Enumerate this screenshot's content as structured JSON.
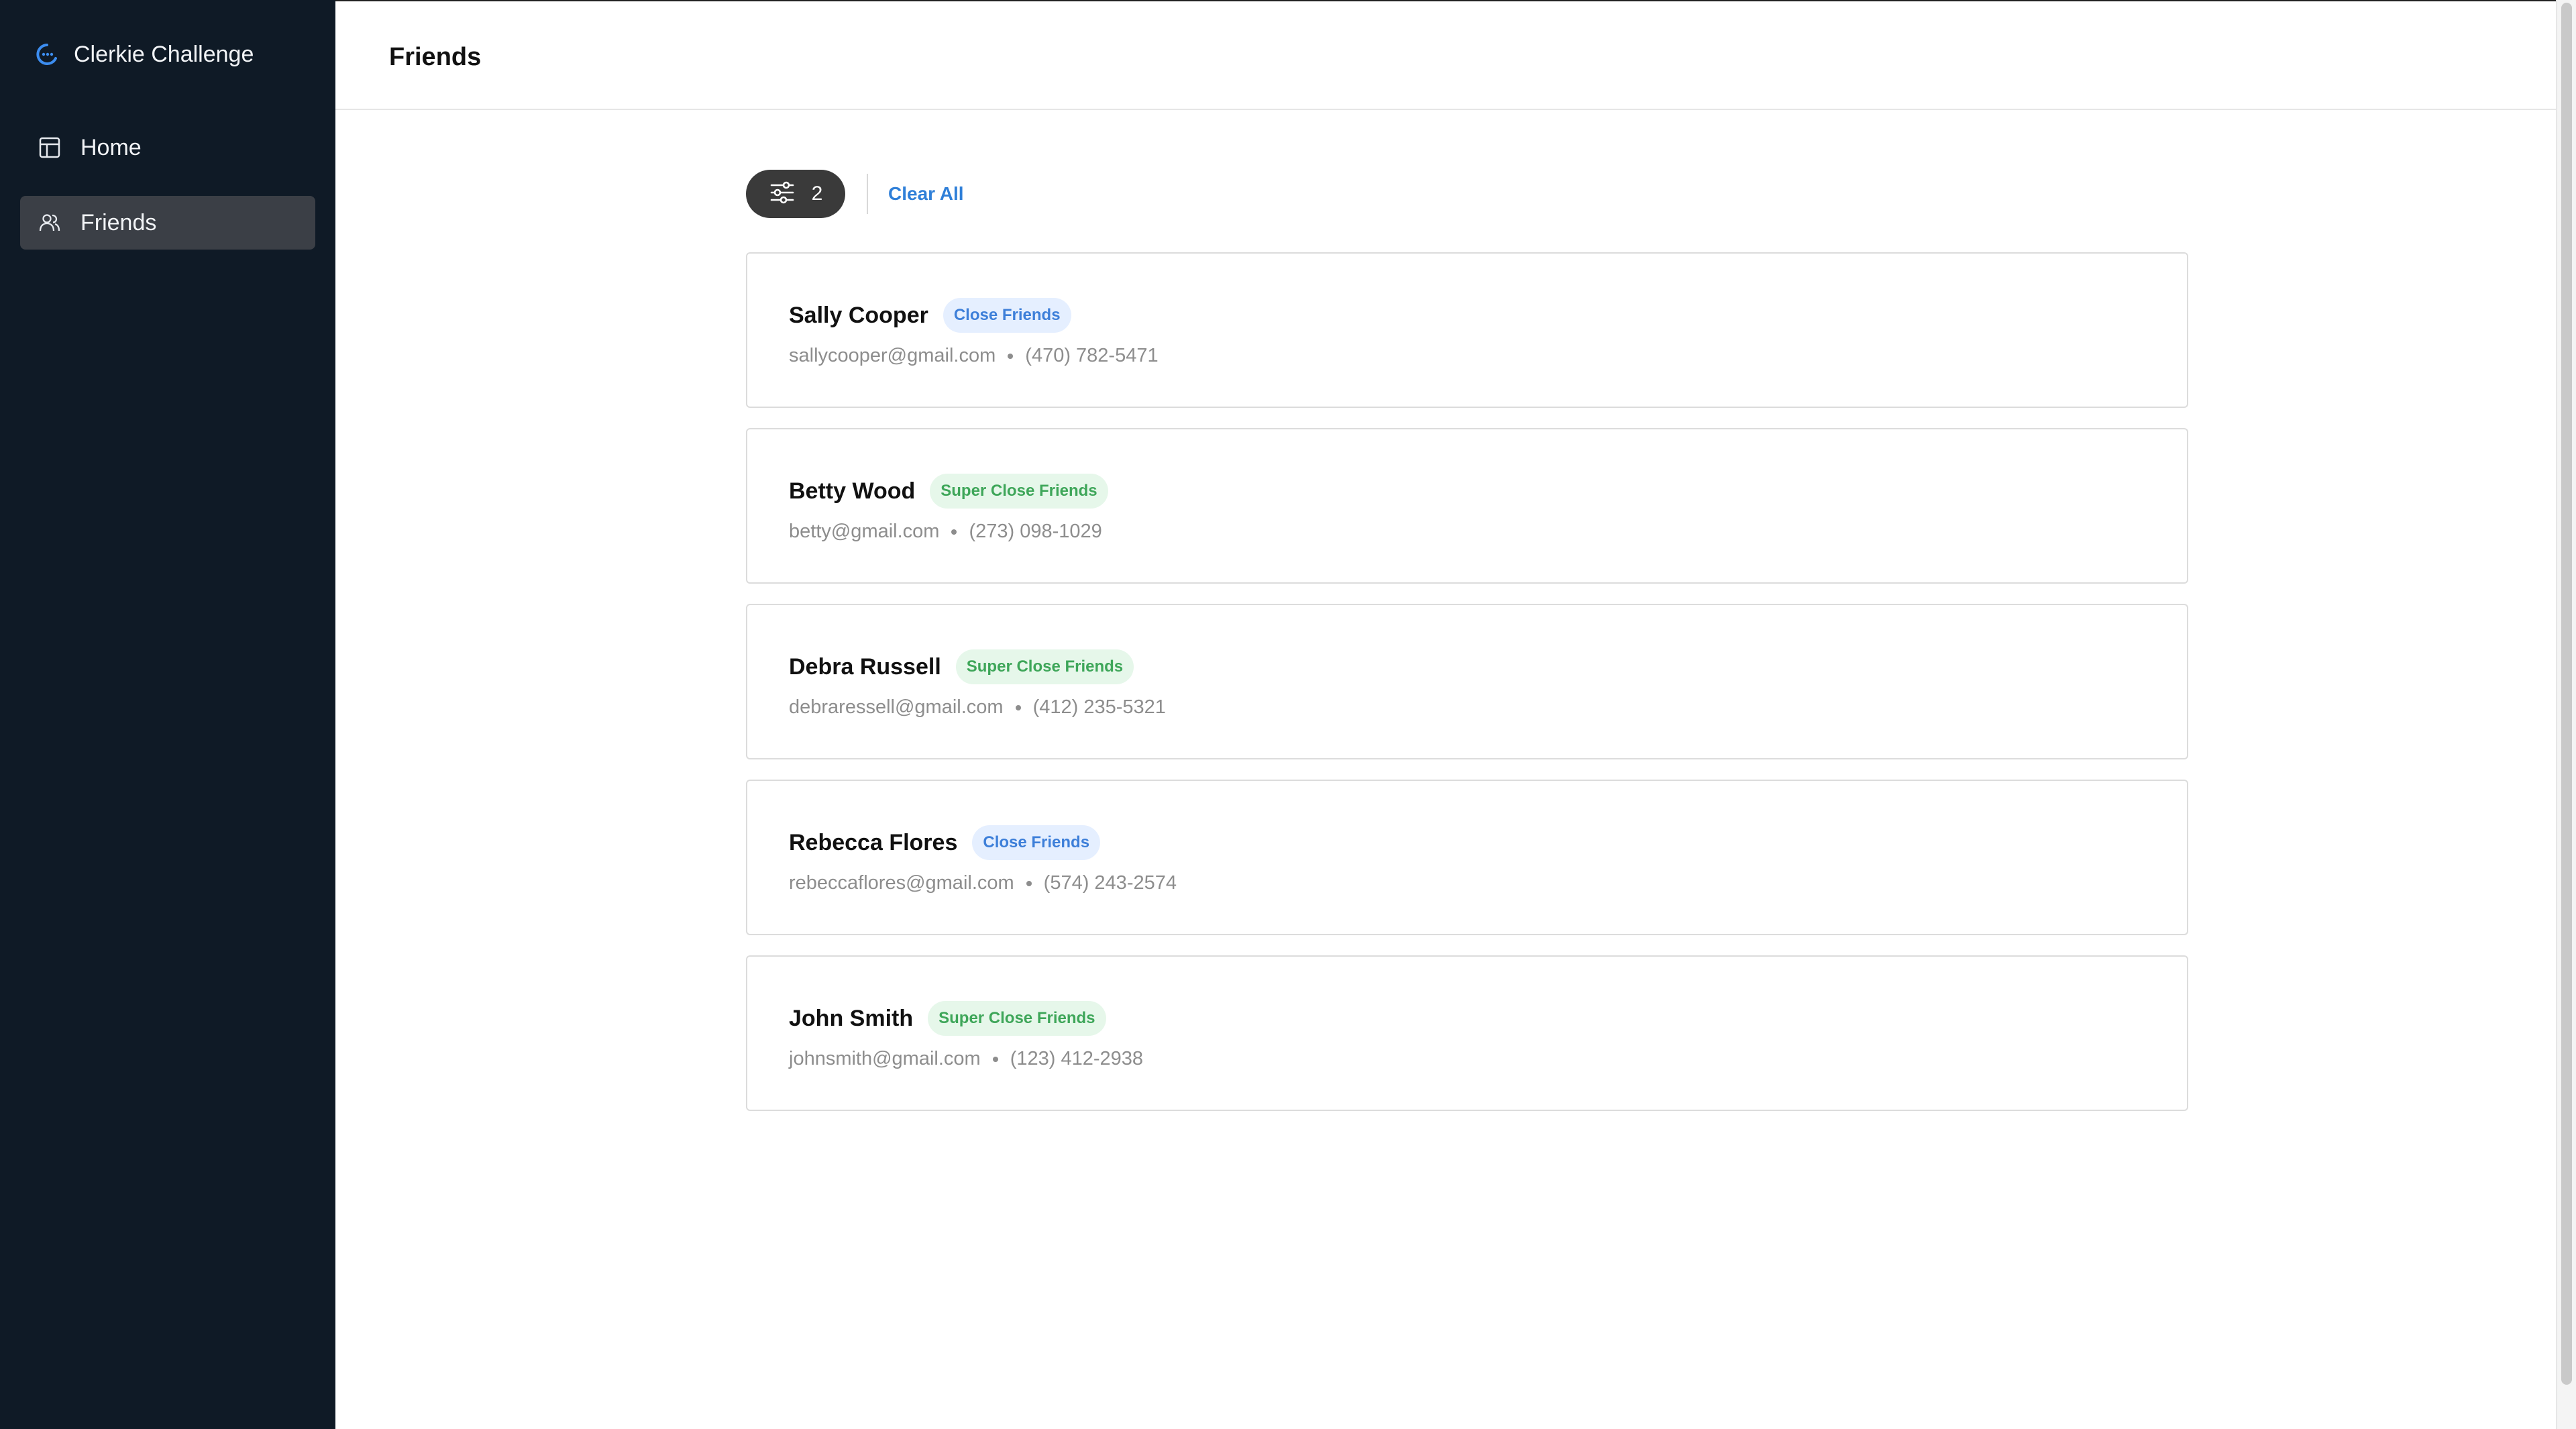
{
  "app": {
    "title": "Clerkie Challenge"
  },
  "sidebar": {
    "items": [
      {
        "label": "Home",
        "icon": "layout-icon",
        "active": false
      },
      {
        "label": "Friends",
        "icon": "users-icon",
        "active": true
      }
    ]
  },
  "header": {
    "title": "Friends"
  },
  "filters": {
    "count": "2",
    "clear_label": "Clear All",
    "icon": "sliders-icon"
  },
  "friends": [
    {
      "name": "Sally Cooper",
      "tag": "Close Friends",
      "tag_color": "#3d7fd9",
      "email": "sallycooper@gmail.com",
      "phone": "(470) 782-5471"
    },
    {
      "name": "Betty Wood",
      "tag": "Super Close Friends",
      "tag_color": "#3ea659",
      "email": "betty@gmail.com",
      "phone": "(273) 098-1029"
    },
    {
      "name": "Debra Russell",
      "tag": "Super Close Friends",
      "tag_color": "#3ea659",
      "email": "debraressell@gmail.com",
      "phone": "(412) 235-5321"
    },
    {
      "name": "Rebecca Flores",
      "tag": "Close Friends",
      "tag_color": "#3d7fd9",
      "email": "rebeccaflores@gmail.com",
      "phone": "(574) 243-2574"
    },
    {
      "name": "John Smith",
      "tag": "Super Close Friends",
      "tag_color": "#3ea659",
      "email": "johnsmith@gmail.com",
      "phone": "(123) 412-2938"
    }
  ],
  "colors": {
    "sidebar_bg": "#0f1a26",
    "active_nav_bg": "#3b3f46",
    "accent": "#2f7fd8",
    "close_tag": "#3d7fd9",
    "super_close_tag": "#3ea659"
  }
}
